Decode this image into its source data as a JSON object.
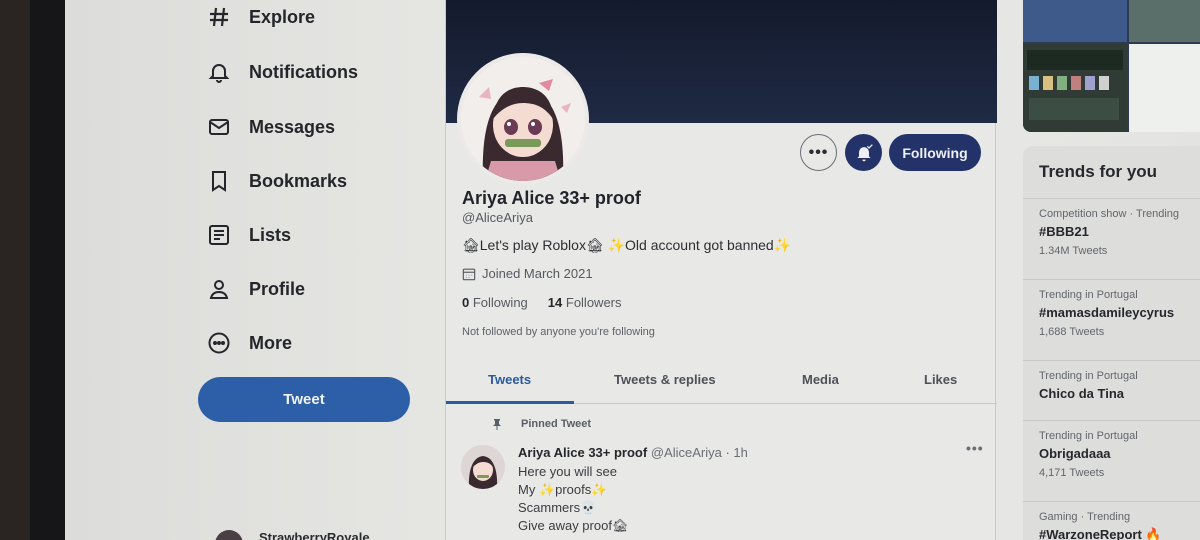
{
  "nav": {
    "items": [
      {
        "label": "Explore",
        "icon": "hashtag-icon"
      },
      {
        "label": "Notifications",
        "icon": "bell-icon"
      },
      {
        "label": "Messages",
        "icon": "envelope-icon"
      },
      {
        "label": "Bookmarks",
        "icon": "bookmark-icon"
      },
      {
        "label": "Lists",
        "icon": "list-icon"
      },
      {
        "label": "Profile",
        "icon": "person-icon"
      },
      {
        "label": "More",
        "icon": "more-circle-icon"
      }
    ],
    "tweet_button": "Tweet",
    "account_name": "StrawberryRoyale"
  },
  "profile": {
    "display_name": "Ariya Alice 33+ proof",
    "handle": "@AliceAriya",
    "bio": "🏚Let's play Roblox🏚 ✨Old account got banned✨",
    "joined": "Joined March 2021",
    "following_count": "0",
    "following_label": "Following",
    "followers_count": "14",
    "followers_label": "Followers",
    "not_followed": "Not followed by anyone you're following",
    "more_button": "•••",
    "following_button": "Following"
  },
  "tabs": [
    {
      "label": "Tweets",
      "active": true
    },
    {
      "label": "Tweets & replies",
      "active": false
    },
    {
      "label": "Media",
      "active": false
    },
    {
      "label": "Likes",
      "active": false
    }
  ],
  "pinned_tweet": {
    "pinned_label": "Pinned Tweet",
    "name": "Ariya Alice 33+ proof",
    "handle_time": "@AliceAriya · 1h",
    "more": "•••",
    "lines": [
      "Here you will see",
      "My ✨proofs✨",
      "Scammers💀",
      "Give away proof🏚"
    ]
  },
  "trends": {
    "title": "Trends for you",
    "items": [
      {
        "meta": "Competition show · Trending",
        "name": "#BBB21",
        "count": "1.34M Tweets"
      },
      {
        "meta": "Trending in Portugal",
        "name": "#mamasdamileycyrus",
        "count": "1,688 Tweets"
      },
      {
        "meta": "Trending in Portugal",
        "name": "Chico da Tina",
        "count": ""
      },
      {
        "meta": "Trending in Portugal",
        "name": "Obrigadaaa",
        "count": "4,171 Tweets"
      },
      {
        "meta": "Gaming · Trending",
        "name": "#WarzoneReport 🔥",
        "count": ""
      }
    ]
  },
  "colors": {
    "accent": "#2c5fa8",
    "following_button": "#23336a",
    "banner": "#1a2238"
  }
}
